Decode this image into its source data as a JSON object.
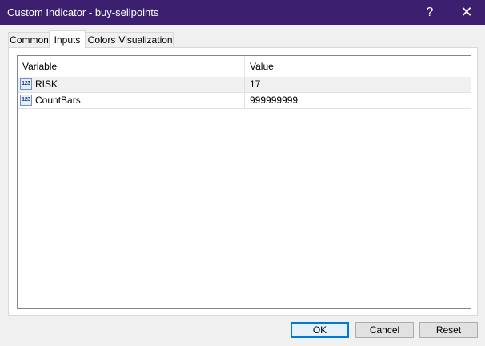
{
  "window": {
    "title": "Custom Indicator - buy-sellpoints",
    "help_glyph": "?",
    "close_glyph": "✕"
  },
  "tabs": [
    {
      "label": "Common"
    },
    {
      "label": "Inputs",
      "active": true
    },
    {
      "label": "Colors"
    },
    {
      "label": "Visualization"
    }
  ],
  "grid": {
    "headers": {
      "variable": "Variable",
      "value": "Value"
    },
    "rows": [
      {
        "icon": "numeric-123-icon",
        "icon_text": "123",
        "name": "RISK",
        "value": "17"
      },
      {
        "icon": "numeric-123-icon",
        "icon_text": "123",
        "name": "CountBars",
        "value": "999999999"
      }
    ]
  },
  "buttons": {
    "ok": "OK",
    "cancel": "Cancel",
    "reset": "Reset"
  },
  "colors": {
    "titlebar": "#3c1f6e",
    "focus": "#0078d7"
  }
}
